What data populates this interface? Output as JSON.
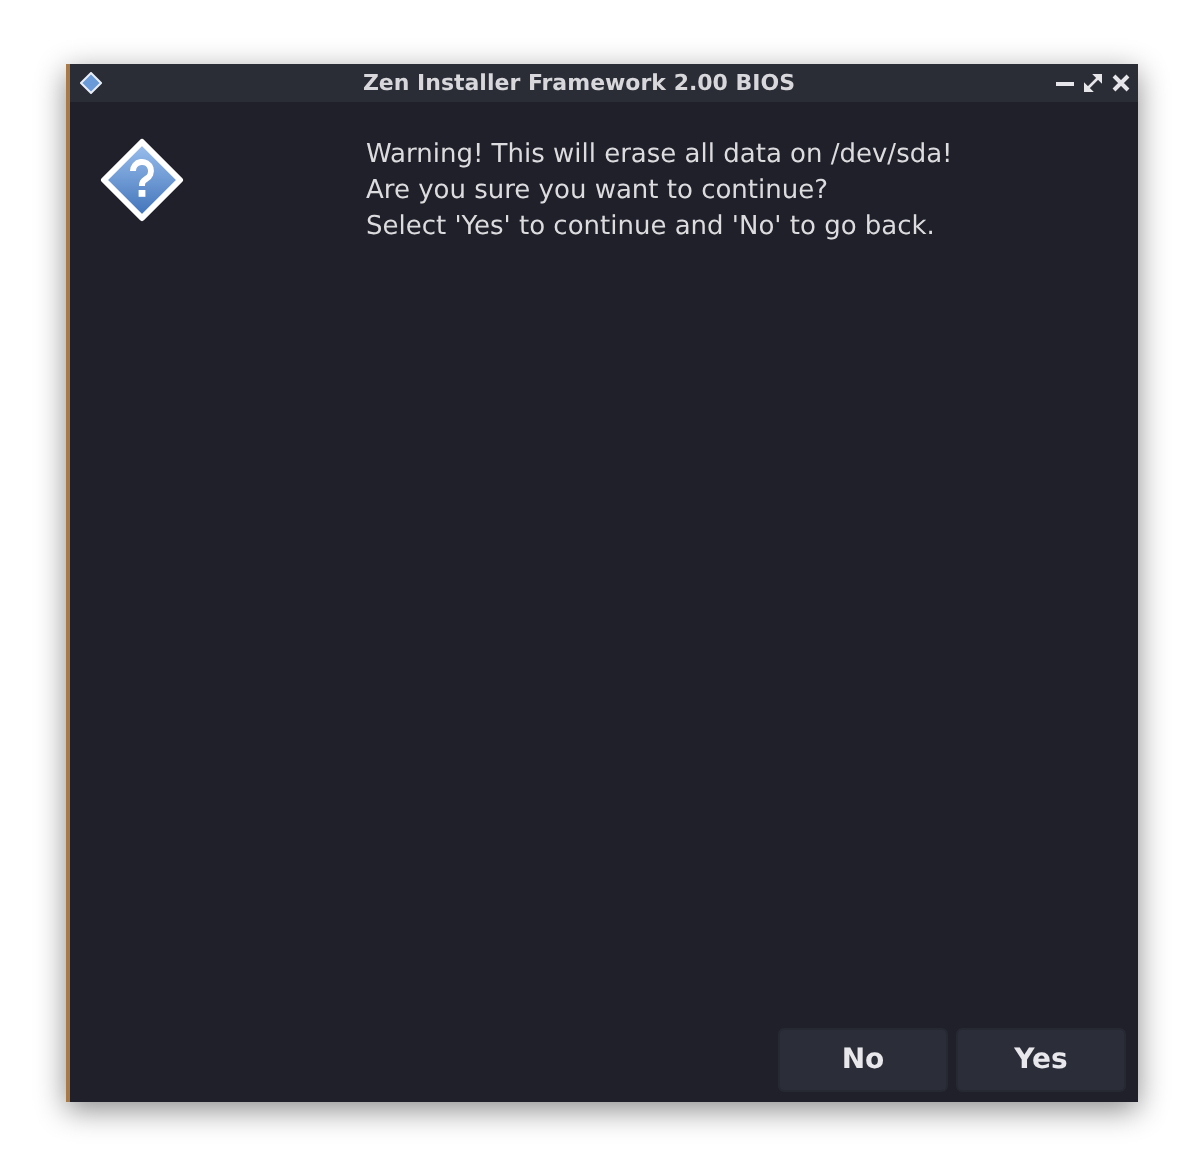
{
  "window": {
    "title": "Zen Installer Framework 2.00 BIOS"
  },
  "message": {
    "lines": [
      "Warning! This will erase all data on /dev/sda!",
      "Are you sure you want to continue?",
      "Select 'Yes' to continue and 'No' to go back."
    ]
  },
  "buttons": [
    {
      "label": "No"
    },
    {
      "label": "Yes"
    }
  ]
}
